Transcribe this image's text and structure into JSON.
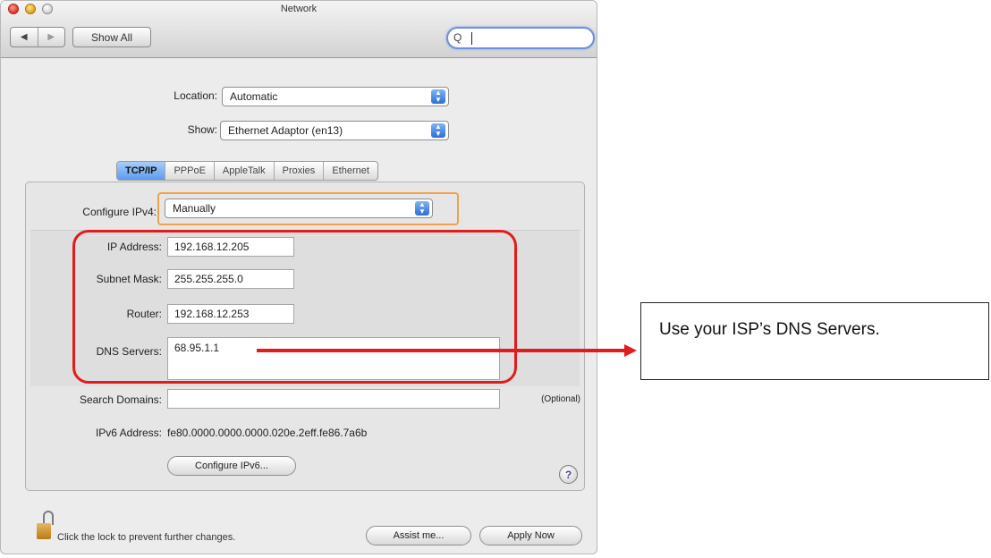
{
  "window": {
    "title": "Network",
    "toolbar": {
      "back_glyph": "◀",
      "forward_glyph": "▶",
      "show_all_label": "Show All",
      "search_icon_glyph": "Q",
      "search_value": ""
    }
  },
  "location": {
    "label": "Location:",
    "value": "Automatic"
  },
  "show": {
    "label": "Show:",
    "value": "Ethernet Adaptor (en13)"
  },
  "tabs": [
    {
      "label": "TCP/IP",
      "active": true
    },
    {
      "label": "PPPoE",
      "active": false
    },
    {
      "label": "AppleTalk",
      "active": false
    },
    {
      "label": "Proxies",
      "active": false
    },
    {
      "label": "Ethernet",
      "active": false
    }
  ],
  "configure_ipv4": {
    "label": "Configure IPv4:",
    "value": "Manually"
  },
  "ip_address": {
    "label": "IP Address:",
    "value": "192.168.12.205"
  },
  "subnet_mask": {
    "label": "Subnet Mask:",
    "value": "255.255.255.0"
  },
  "router": {
    "label": "Router:",
    "value": "192.168.12.253"
  },
  "dns_servers": {
    "label": "DNS Servers:",
    "value": "68.95.1.1"
  },
  "search_domains": {
    "label": "Search Domains:",
    "value": "",
    "hint": "(Optional)"
  },
  "ipv6_address": {
    "label": "IPv6 Address:",
    "value": "fe80.0000.0000.0000.020e.2eff.fe86.7a6b"
  },
  "configure_ipv6_label": "Configure IPv6...",
  "help_glyph": "?",
  "lock_text": "Click the lock to prevent further changes.",
  "assist_label": "Assist me...",
  "apply_label": "Apply Now",
  "callout": {
    "text": "Use your ISP’s DNS Servers."
  },
  "colors": {
    "annotation_red": "#e21b1b",
    "focus_orange": "#f0a24a",
    "selected_blue": "#5d9bee"
  }
}
